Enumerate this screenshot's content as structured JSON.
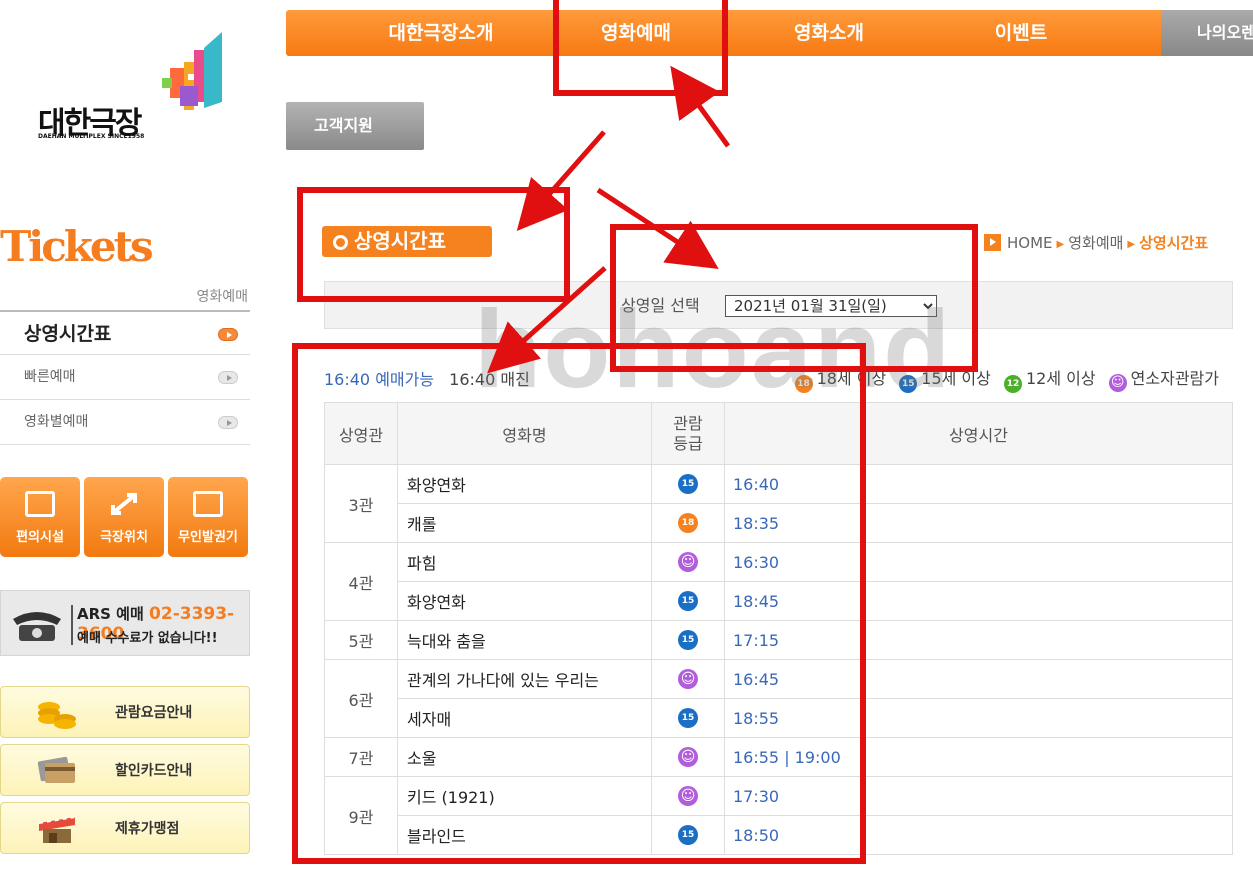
{
  "logo": {
    "name": "대한극장",
    "sub": "DAEHAN MULTIPLEX SINCE1958"
  },
  "nav": {
    "items": [
      "대한극장소개",
      "영화예매",
      "영화소개",
      "이벤트"
    ],
    "extra": "나의오렌",
    "support": "고객지원"
  },
  "sidebar": {
    "title": "Tickets",
    "sub": "영화예매",
    "menu": [
      "상영시간표",
      "빠른예매",
      "영화별예매"
    ],
    "icon_buttons": [
      "편의시설",
      "극장위치",
      "무인발권기"
    ],
    "ars": {
      "label": "ARS 예매",
      "phone": "02-3393-3600",
      "note": "예매 수수료가 없습니다!!"
    },
    "links": [
      "관람요금안내",
      "할인카드안내",
      "제휴가맹점"
    ]
  },
  "page": {
    "title": "상영시간표",
    "breadcrumb": [
      "HOME",
      "영화예매",
      "상영시간표"
    ]
  },
  "date_select": {
    "label": "상영일 선택",
    "value": "2021년 01월 31일(일)"
  },
  "watermark": "hohoand",
  "status": {
    "available": "16:40 예매가능",
    "sold_out": "16:40 매진"
  },
  "legend": [
    {
      "badge": "18",
      "label": "18세 이상",
      "color": "#f5821f"
    },
    {
      "badge": "15",
      "label": "15세 이상",
      "color": "#1a6fc4"
    },
    {
      "badge": "12",
      "label": "12세 이상",
      "color": "#4caf2a"
    },
    {
      "badge": "☺",
      "label": "연소자관람가",
      "color": "#b25ddb"
    }
  ],
  "table": {
    "headers": [
      "상영관",
      "영화명",
      "관람\n등급",
      "상영시간"
    ],
    "groups": [
      {
        "hall": "3관",
        "rows": [
          {
            "movie": "화양연화",
            "rating": "15",
            "times": "16:40"
          },
          {
            "movie": "캐롤",
            "rating": "18",
            "times": "18:35"
          }
        ]
      },
      {
        "hall": "4관",
        "rows": [
          {
            "movie": "파힘",
            "rating": "all",
            "times": "16:30"
          },
          {
            "movie": "화양연화",
            "rating": "15",
            "times": "18:45"
          }
        ]
      },
      {
        "hall": "5관",
        "rows": [
          {
            "movie": "늑대와 춤을",
            "rating": "15",
            "times": "17:15"
          }
        ]
      },
      {
        "hall": "6관",
        "rows": [
          {
            "movie": "관계의 가나다에 있는 우리는",
            "rating": "all",
            "times": "16:45"
          },
          {
            "movie": "세자매",
            "rating": "15",
            "times": "18:55"
          }
        ]
      },
      {
        "hall": "7관",
        "rows": [
          {
            "movie": "소울",
            "rating": "all",
            "times": "16:55 | 19:00"
          }
        ]
      },
      {
        "hall": "9관",
        "rows": [
          {
            "movie": "키드 (1921)",
            "rating": "all",
            "times": "17:30"
          },
          {
            "movie": "블라인드",
            "rating": "15",
            "times": "18:50"
          }
        ]
      }
    ]
  },
  "colors": {
    "accent": "#f5821f",
    "annotation": "#e01010",
    "link": "#3a68b8"
  }
}
